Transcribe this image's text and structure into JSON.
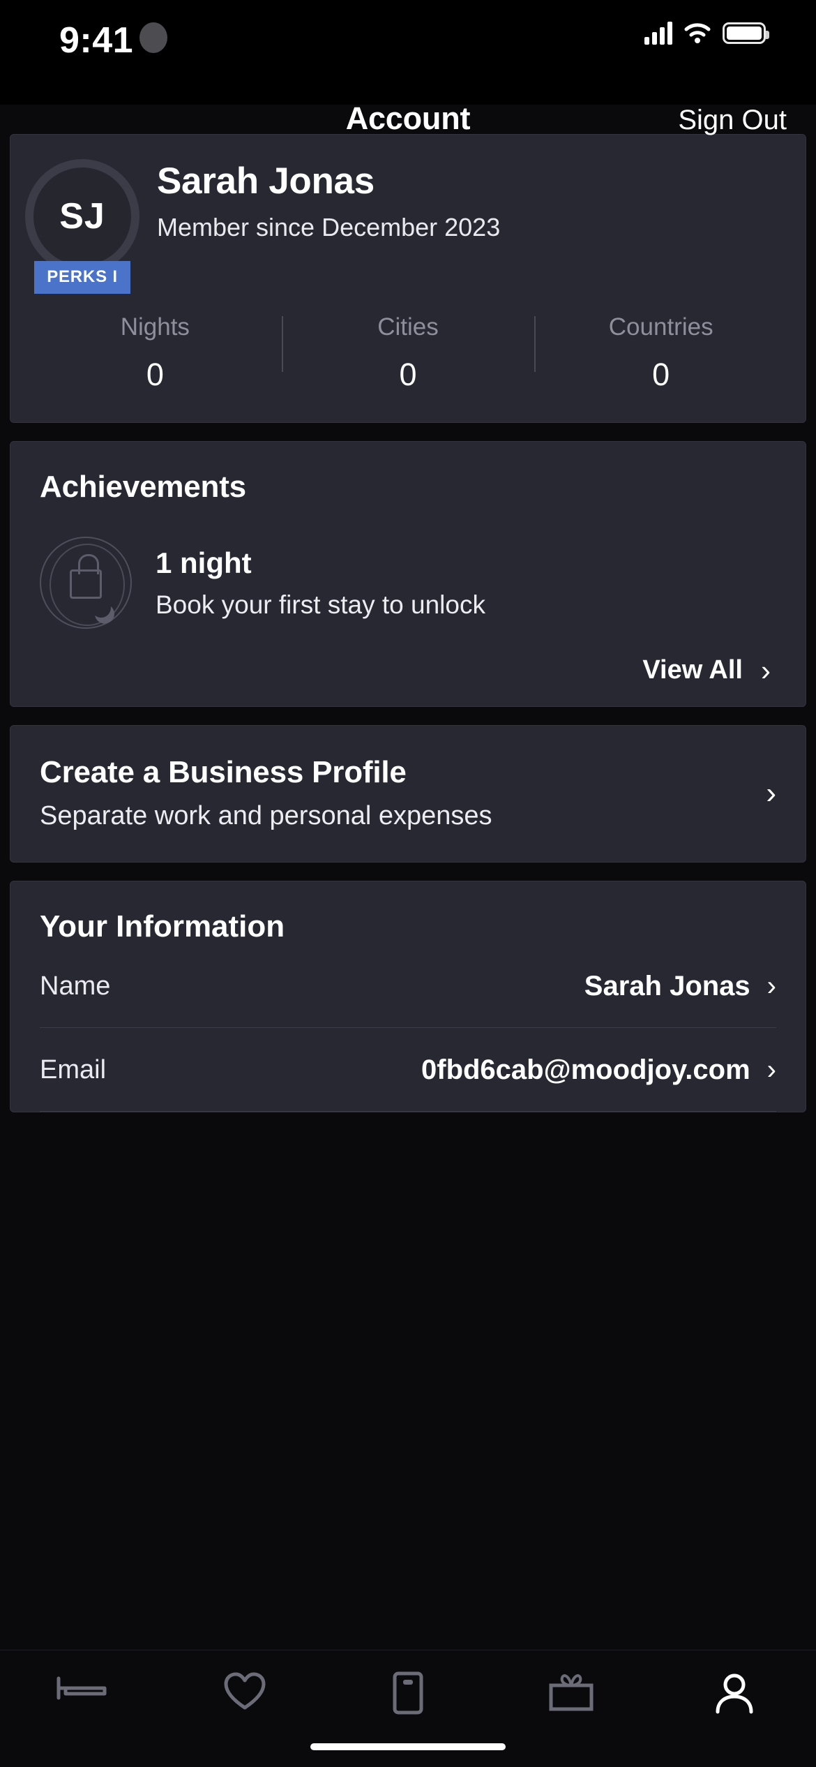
{
  "status_bar": {
    "time": "9:41",
    "cellular_icon": "signal-bars-icon",
    "wifi_icon": "wifi-icon",
    "battery_icon": "battery-icon"
  },
  "header": {
    "title": "Account",
    "sign_out_label": "Sign Out"
  },
  "profile": {
    "initials": "SJ",
    "perks_badge": "PERKS I",
    "name": "Sarah Jonas",
    "member_since": "Member since December 2023",
    "stats": [
      {
        "label": "Nights",
        "value": "0"
      },
      {
        "label": "Cities",
        "value": "0"
      },
      {
        "label": "Countries",
        "value": "0"
      }
    ]
  },
  "achievements": {
    "title": "Achievements",
    "item": {
      "name": "1 night",
      "description": "Book your first stay to unlock",
      "badge_icon": "locked-moon-badge-icon"
    },
    "view_all_label": "View All",
    "view_all_chevron": "›"
  },
  "business_profile": {
    "title": "Create a Business Profile",
    "subtitle": "Separate work and personal expenses",
    "chevron": "›"
  },
  "your_information": {
    "title": "Your Information",
    "rows": [
      {
        "label": "Name",
        "value": "Sarah Jonas",
        "chevron": "›"
      },
      {
        "label": "Email",
        "value": "0fbd6cab@moodjoy.com",
        "chevron": "›"
      }
    ]
  },
  "tab_bar": {
    "items": [
      {
        "icon": "bed-stays-icon",
        "active": false
      },
      {
        "icon": "heart-favorites-icon",
        "active": false
      },
      {
        "icon": "card-wallet-icon",
        "active": false
      },
      {
        "icon": "gift-rewards-icon",
        "active": false
      },
      {
        "icon": "person-account-icon",
        "active": true
      }
    ]
  },
  "colors": {
    "background": "#0a0a0c",
    "card": "#282833",
    "accent_badge": "#4b73c9",
    "muted_text": "#8f8f9b",
    "primary_text": "#ffffff"
  }
}
